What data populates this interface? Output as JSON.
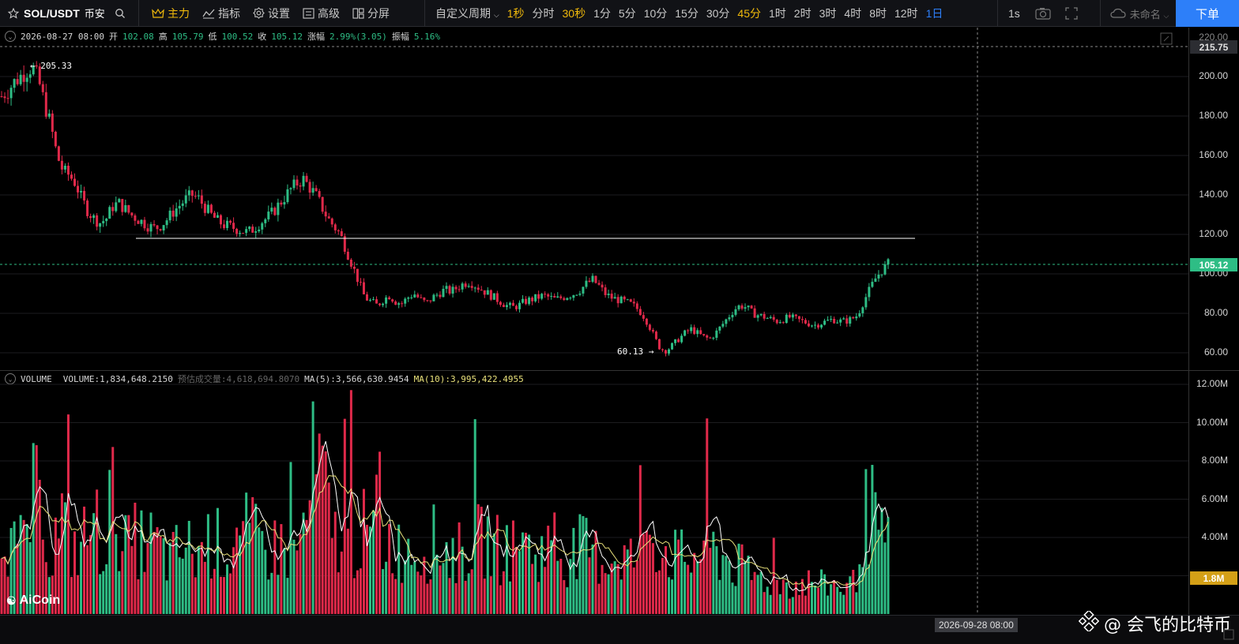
{
  "toolbar": {
    "symbol": "SOL/USDT",
    "exchange": "币安",
    "main_label": "主力",
    "indicator_label": "指标",
    "settings_label": "设置",
    "advanced_label": "高级",
    "split_label": "分屏",
    "custom_period_label": "自定义周期",
    "periods": [
      "1秒",
      "分时",
      "30秒",
      "1分",
      "5分",
      "10分",
      "15分",
      "30分",
      "45分",
      "1时",
      "2时",
      "3时",
      "4时",
      "8时",
      "12时",
      "1日"
    ],
    "highlighted_periods": [
      "1秒",
      "30秒",
      "45分"
    ],
    "active_period": "1日",
    "interval_label": "1s",
    "layout_name": "未命名",
    "order_button": "下单"
  },
  "ohlc": {
    "date": "2026-08-27 08:00",
    "open_label": "开",
    "open": "102.08",
    "high_label": "高",
    "high": "105.79",
    "low_label": "低",
    "low": "100.52",
    "close_label": "收",
    "close": "105.12",
    "change_label": "涨幅",
    "change": "2.99%(3.05)",
    "amplitude_label": "振幅",
    "amplitude": "5.16%"
  },
  "volume_info": {
    "name": "VOLUME",
    "volume": "VOLUME:1,834,648.2150",
    "estimated": "预估成交量:4,618,694.8070",
    "ma5": "MA(5):3,566,630.9454",
    "ma10": "MA(10):3,995,422.4955"
  },
  "price_axis": {
    "ticks": [
      "200.00",
      "180.00",
      "160.00",
      "140.00",
      "120.00",
      "100.00",
      "80.00",
      "60.00"
    ],
    "top_partial": "220.00",
    "crosshair_price": "215.75",
    "current_price": "105.12",
    "high_marker": "205.33",
    "low_marker": "60.13"
  },
  "volume_axis": {
    "ticks": [
      "12.00M",
      "10.00M",
      "8.00M",
      "6.00M",
      "4.00M"
    ],
    "current_volume": "1.8M"
  },
  "crosshair_date": "2026-09-28 08:00",
  "logo_text": "AiCoin",
  "watermark_text": "@ 会飞的比特币",
  "colors": {
    "up": "#2ebd85",
    "down": "#e0294a",
    "accent": "#f0b90b",
    "blue": "#2d7ff9",
    "ma5": "#ffffff",
    "ma10": "#e8e07a"
  },
  "chart_data": {
    "type": "candlestick",
    "price_ylim": [
      50,
      225
    ],
    "volume_ylim": [
      0,
      12000000
    ],
    "price_path": [
      190,
      193,
      197,
      200,
      203,
      205,
      198,
      186,
      175,
      160,
      152,
      150,
      146,
      138,
      132,
      128,
      126,
      128,
      134,
      136,
      133,
      130,
      128,
      126,
      124,
      123,
      125,
      128,
      132,
      135,
      138,
      140,
      138,
      134,
      130,
      127,
      125,
      124,
      123,
      122,
      121,
      123,
      126,
      128,
      131,
      135,
      139,
      143,
      146,
      148,
      144,
      140,
      134,
      128,
      124,
      120,
      112,
      104,
      96,
      88,
      86,
      84,
      87,
      89,
      86,
      85,
      88,
      90,
      87,
      85,
      88,
      90,
      92,
      91,
      93,
      95,
      96,
      94,
      92,
      90,
      88,
      86,
      84,
      83,
      84,
      86,
      87,
      88,
      89,
      88,
      87,
      88,
      89,
      90,
      92,
      95,
      97,
      94,
      90,
      88,
      87,
      86,
      85,
      83,
      80,
      75,
      68,
      62,
      61,
      64,
      67,
      70,
      72,
      70,
      68,
      67,
      70,
      74,
      78,
      82,
      84,
      83,
      80,
      79,
      78,
      77,
      76,
      77,
      78,
      77,
      76,
      75,
      74,
      75,
      76,
      77,
      76,
      76,
      77,
      79,
      86,
      92,
      98,
      102,
      105
    ],
    "volume_path": [
      5.5,
      3.8,
      3.0,
      4.5,
      6.2,
      4.0,
      3.1,
      5.2,
      3.6,
      3.3,
      4.1,
      4.9,
      3.5,
      6.1,
      4.8,
      3.4,
      3.9,
      3.6,
      3.8,
      3.1,
      2.8,
      3.3,
      3.5,
      3.0,
      3.6,
      4.0,
      3.4,
      3.2,
      3.6,
      4.2,
      3.9,
      3.5,
      3.3,
      3.7,
      3.1,
      3.4,
      4.6,
      7.7,
      6.8,
      4.2,
      4.0,
      3.6,
      3.9,
      4.3,
      3.7,
      3.5,
      3.9,
      3.3,
      3.6,
      3.4,
      3.2,
      3.8,
      3.5,
      3.3,
      3.1,
      3.4,
      3.6,
      3.9,
      3.7,
      3.3,
      3.6,
      3.2,
      3.5,
      3.1,
      3.3,
      3.4,
      3.2,
      3.0,
      3.3,
      3.5,
      3.1,
      3.0,
      2.8,
      3.2,
      3.0,
      2.9,
      3.1,
      4.5,
      3.6,
      3.2,
      3.0,
      2.8,
      2.9,
      3.6,
      3.4,
      3.1,
      2.9,
      2.5,
      2.3,
      2.0,
      1.9,
      1.7,
      1.7,
      1.6,
      1.5,
      1.6,
      1.7,
      1.5,
      1.6,
      1.5,
      1.4,
      1.6,
      4.8,
      5.3,
      4.3,
      1.8
    ]
  }
}
